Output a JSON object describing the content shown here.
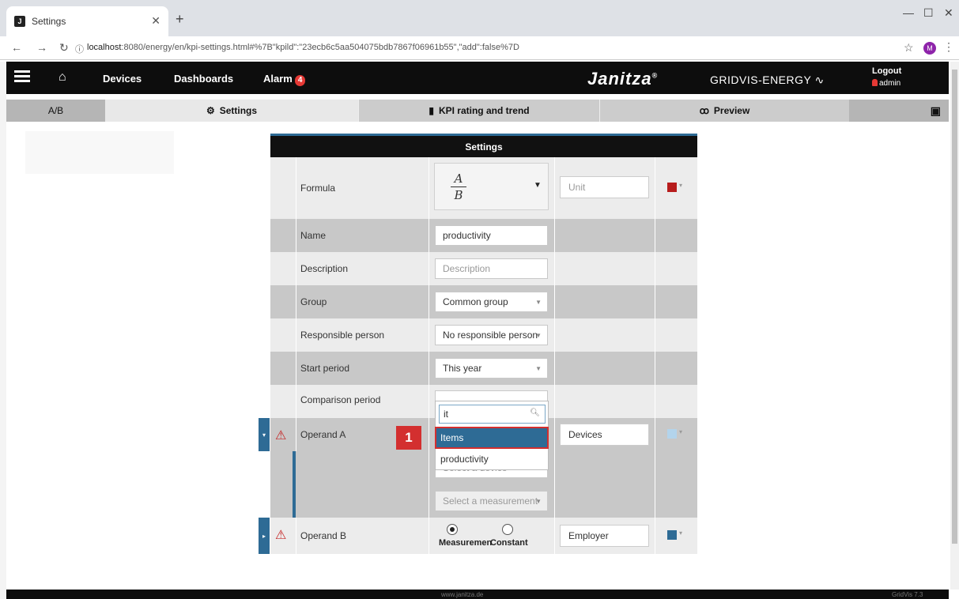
{
  "browser": {
    "tab_title": "Settings",
    "tab_favicon": "J",
    "url_host": "localhost",
    "url_rest": ":8080/energy/en/kpi-settings.html#%7B\"kpild\":\"23ecb6c5aa504075bdb7867f06961b55\",\"add\":false%7D",
    "profile_initial": "M"
  },
  "header": {
    "nav": {
      "devices": "Devices",
      "dashboards": "Dashboards",
      "alarm": "Alarm",
      "alarm_count": "4"
    },
    "brand": "Janitza",
    "brand_reg": "®",
    "brand_sub": "GRIDVIS-ENERGY",
    "logout": "Logout",
    "user": "admin"
  },
  "subtabs": {
    "ab": "A/B",
    "settings": "Settings",
    "kpi": "KPI rating and trend",
    "preview": "Preview"
  },
  "panel": {
    "title": "Settings",
    "formula": {
      "label": "Formula",
      "numerator": "A",
      "denominator": "B",
      "unit_placeholder": "Unit",
      "color": "#b71c1c"
    },
    "name": {
      "label": "Name",
      "value": "productivity"
    },
    "description": {
      "label": "Description",
      "placeholder": "Description"
    },
    "group": {
      "label": "Group",
      "value": "Common group"
    },
    "responsible": {
      "label": "Responsible person",
      "value": "No responsible person"
    },
    "start_period": {
      "label": "Start period",
      "value": "This year"
    },
    "comparison_period": {
      "label": "Comparison period"
    },
    "operand_a": {
      "label": "Operand A",
      "value": "Devices",
      "color": "#b3d4ec",
      "device_placeholder": "Select a device",
      "measurement_placeholder": "Select a measurement"
    },
    "operand_b": {
      "label": "Operand B",
      "value": "Employer",
      "color": "#2e6b95",
      "radio1": "Measuremen",
      "radio2": "Constant"
    }
  },
  "dropdown": {
    "search_value": "it",
    "options": [
      "Items",
      "productivity"
    ]
  },
  "step_badge": "1",
  "footer": {
    "left": "www.janitza.de",
    "right": "GridVis 7.3"
  }
}
